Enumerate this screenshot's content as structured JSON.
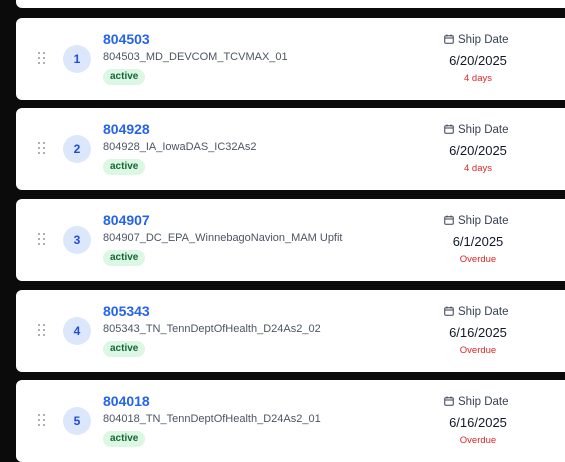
{
  "ship_date_label": "Ship Date",
  "items": [
    {
      "index": "1",
      "id": "804503",
      "name": "804503_MD_DEVCOM_TCVMAX_01",
      "status": "active",
      "ship_date": "6/20/2025",
      "due": "4 days"
    },
    {
      "index": "2",
      "id": "804928",
      "name": "804928_IA_IowaDAS_IC32As2",
      "status": "active",
      "ship_date": "6/20/2025",
      "due": "4 days"
    },
    {
      "index": "3",
      "id": "804907",
      "name": "804907_DC_EPA_WinnebagoNavion_MAM Upfit",
      "status": "active",
      "ship_date": "6/1/2025",
      "due": "Overdue"
    },
    {
      "index": "4",
      "id": "805343",
      "name": "805343_TN_TennDeptOfHealth_D24As2_02",
      "status": "active",
      "ship_date": "6/16/2025",
      "due": "Overdue"
    },
    {
      "index": "5",
      "id": "804018",
      "name": "804018_TN_TennDeptOfHealth_D24As2_01",
      "status": "active",
      "ship_date": "6/16/2025",
      "due": "Overdue"
    }
  ]
}
